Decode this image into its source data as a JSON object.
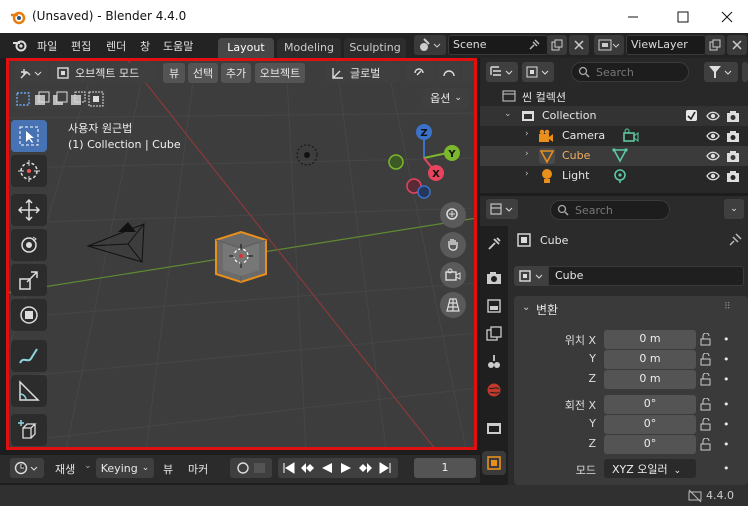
{
  "window": {
    "title": "(Unsaved) - Blender 4.4.0"
  },
  "menubar": {
    "items": [
      "파일",
      "편집",
      "렌더",
      "창",
      "도움말"
    ],
    "tabs": [
      "Layout",
      "Modeling",
      "Sculpting"
    ],
    "scene": "Scene",
    "viewlayer": "ViewLayer"
  },
  "viewport": {
    "mode": "오브젝트 모드",
    "view": "뷰",
    "select": "선택",
    "add": "추가",
    "object": "오브젝트",
    "orientation": "글로벌",
    "options": "옵션",
    "perspective_label": "사용자 원근법",
    "collection_label": "(1) Collection | Cube",
    "gizmo": {
      "x": "X",
      "y": "Y",
      "z": "Z"
    }
  },
  "timeline": {
    "playback": "재생",
    "keying": "Keying",
    "view": "뷰",
    "marker": "마커",
    "frame": "1"
  },
  "outliner": {
    "search_placeholder": "Search",
    "scene_collection": "씬 컬렉션",
    "items": [
      {
        "label": "Collection"
      },
      {
        "label": "Camera"
      },
      {
        "label": "Cube"
      },
      {
        "label": "Light"
      }
    ]
  },
  "properties": {
    "search_placeholder": "Search",
    "object_name": "Cube",
    "data_name": "Cube",
    "panel_title": "변환",
    "location_label": "위치 X",
    "rotation_label": "회전 X",
    "axis_y": "Y",
    "axis_z": "Z",
    "location": [
      "0 m",
      "0 m",
      "0 m"
    ],
    "rotation": [
      "0°",
      "0°",
      "0°"
    ],
    "mode_label": "모드",
    "rotation_mode": "XYZ 오일러"
  },
  "status": {
    "version": "4.4.0"
  },
  "colors": {
    "active": "#e88f1c",
    "accent": "#4772b3",
    "border": "#e01010"
  }
}
